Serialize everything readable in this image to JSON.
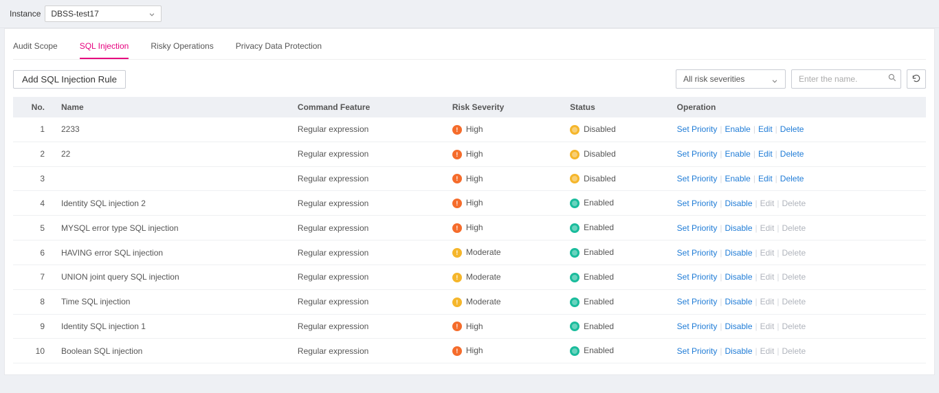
{
  "instance": {
    "label": "Instance",
    "value": "DBSS-test17"
  },
  "tabs": [
    {
      "id": "audit-scope",
      "label": "Audit Scope"
    },
    {
      "id": "sql-injection",
      "label": "SQL Injection"
    },
    {
      "id": "risky-operations",
      "label": "Risky Operations"
    },
    {
      "id": "privacy-data-protection",
      "label": "Privacy Data Protection"
    }
  ],
  "active_tab": "sql-injection",
  "toolbar": {
    "add_rule_label": "Add SQL Injection Rule",
    "severity_filter": "All risk severities",
    "search_placeholder": "Enter the name."
  },
  "columns": {
    "no": "No.",
    "name": "Name",
    "command_feature": "Command Feature",
    "risk_severity": "Risk Severity",
    "status": "Status",
    "operation": "Operation"
  },
  "op_labels": {
    "set_priority": "Set Priority",
    "enable": "Enable",
    "disable": "Disable",
    "edit": "Edit",
    "delete": "Delete"
  },
  "rows": [
    {
      "no": 1,
      "name": "2233",
      "feature": "Regular expression",
      "risk": "High",
      "status": "Disabled"
    },
    {
      "no": 2,
      "name": "22",
      "feature": "Regular expression",
      "risk": "High",
      "status": "Disabled"
    },
    {
      "no": 3,
      "name": " ",
      "feature": "Regular expression",
      "risk": "High",
      "status": "Disabled"
    },
    {
      "no": 4,
      "name": "Identity SQL injection 2",
      "feature": "Regular expression",
      "risk": "High",
      "status": "Enabled"
    },
    {
      "no": 5,
      "name": "MYSQL error type SQL injection",
      "feature": "Regular expression",
      "risk": "High",
      "status": "Enabled"
    },
    {
      "no": 6,
      "name": "HAVING error SQL injection",
      "feature": "Regular expression",
      "risk": "Moderate",
      "status": "Enabled"
    },
    {
      "no": 7,
      "name": "UNION joint query SQL injection",
      "feature": "Regular expression",
      "risk": "Moderate",
      "status": "Enabled"
    },
    {
      "no": 8,
      "name": "Time SQL injection",
      "feature": "Regular expression",
      "risk": "Moderate",
      "status": "Enabled"
    },
    {
      "no": 9,
      "name": "Identity SQL injection 1",
      "feature": "Regular expression",
      "risk": "High",
      "status": "Enabled"
    },
    {
      "no": 10,
      "name": "Boolean SQL injection",
      "feature": "Regular expression",
      "risk": "High",
      "status": "Enabled"
    }
  ]
}
